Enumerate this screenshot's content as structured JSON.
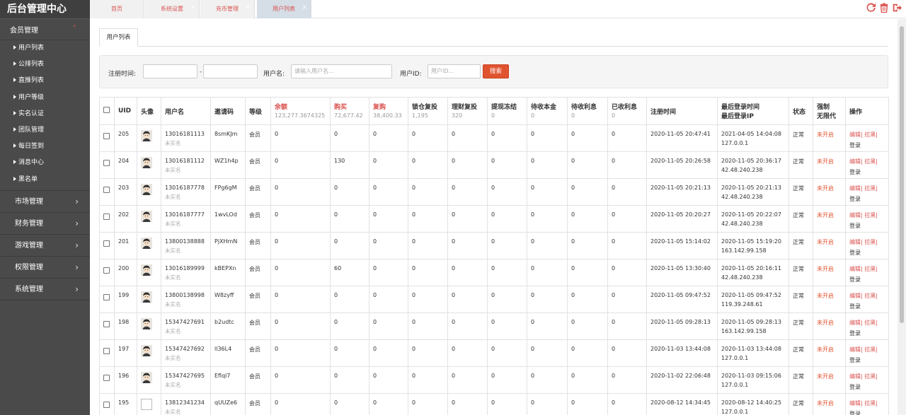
{
  "brand": "后台管理中心",
  "sidebar": {
    "groups": [
      {
        "label": "会员管理",
        "open": true,
        "items": [
          "用户列表",
          "公排列表",
          "直推列表",
          "用户等级",
          "实名认证",
          "团队管理",
          "每日签到",
          "消息中心",
          "黑名单"
        ]
      },
      {
        "label": "市场管理"
      },
      {
        "label": "财务管理"
      },
      {
        "label": "游戏管理"
      },
      {
        "label": "权限管理"
      },
      {
        "label": "系统管理"
      }
    ]
  },
  "top_tabs": [
    {
      "label": "首页",
      "closable": false,
      "active": false
    },
    {
      "label": "系统设置",
      "closable": true,
      "active": false
    },
    {
      "label": "充币管理",
      "closable": true,
      "active": false
    },
    {
      "label": "用户列表",
      "closable": true,
      "active": true
    }
  ],
  "top_icons": [
    "refresh-icon",
    "trash-icon",
    "logout-icon"
  ],
  "page_tab": "用户列表",
  "search": {
    "reg_time_label": "注册时间:",
    "username_label": "用户名:",
    "username_placeholder": "请输入用户名...",
    "userid_label": "用户ID:",
    "userid_placeholder": "用户ID...",
    "button": "搜索"
  },
  "table": {
    "headers": {
      "uid": "UID",
      "avatar": "头像",
      "username": "用户名",
      "invite": "邀请码",
      "level": "等级",
      "balance": {
        "label": "余额",
        "total": "123,277.3674325"
      },
      "buy": {
        "label": "购买",
        "total": "72,677.42"
      },
      "rebuy": {
        "label": "复购",
        "total": "38,400.33"
      },
      "lock": {
        "label": "锁仓复投",
        "total": "1,195"
      },
      "finance": {
        "label": "理财复投",
        "total": "320"
      },
      "freeze": {
        "label": "提现冻结",
        "total": "0"
      },
      "pending_principal": {
        "label": "待收本金",
        "total": "0"
      },
      "pending_interest": {
        "label": "待收利息",
        "total": "0"
      },
      "received_interest": {
        "label": "已收利息",
        "total": "0"
      },
      "reg_time": "注册时间",
      "last_login": "最后登录时间",
      "last_ip": "最后登录IP",
      "status": "状态",
      "force_1": "强制",
      "force_2": "无限代",
      "ops": "操作"
    },
    "rows": [
      {
        "uid": "205",
        "phone": "13016181113",
        "realname": "未实名",
        "code": "8smKJm",
        "level": "会员",
        "balance": "0",
        "buy": "0",
        "rebuy": "0",
        "lock": "0",
        "finance": "0",
        "freeze": "0",
        "pp": "0",
        "pi": "0",
        "ri": "0",
        "reg": "2020-11-05 20:47:41",
        "login": "2021-04-05 14:04:08",
        "ip": "127.0.0.1",
        "status": "正常",
        "force": "未开启",
        "op": "编辑| 拉黑|",
        "op2": "登录",
        "broken": false
      },
      {
        "uid": "204",
        "phone": "13016181112",
        "realname": "未实名",
        "code": "WZ1h4p",
        "level": "会员",
        "balance": "0",
        "buy": "130",
        "rebuy": "0",
        "lock": "0",
        "finance": "0",
        "freeze": "0",
        "pp": "0",
        "pi": "0",
        "ri": "0",
        "reg": "2020-11-05 20:26:58",
        "login": "2020-11-05 20:36:17",
        "ip": "42.48.240.238",
        "status": "正常",
        "force": "未开启",
        "op": "编辑| 拉黑|",
        "op2": "登录",
        "broken": false
      },
      {
        "uid": "203",
        "phone": "13016187778",
        "realname": "未实名",
        "code": "FPg6gM",
        "level": "会员",
        "balance": "0",
        "buy": "0",
        "rebuy": "0",
        "lock": "0",
        "finance": "0",
        "freeze": "0",
        "pp": "0",
        "pi": "0",
        "ri": "0",
        "reg": "2020-11-05 20:21:13",
        "login": "2020-11-05 20:21:13",
        "ip": "42.48.240.238",
        "status": "正常",
        "force": "未开启",
        "op": "编辑| 拉黑|",
        "op2": "登录",
        "broken": false
      },
      {
        "uid": "202",
        "phone": "13016187777",
        "realname": "未实名",
        "code": "1wvLOd",
        "level": "会员",
        "balance": "0",
        "buy": "0",
        "rebuy": "0",
        "lock": "0",
        "finance": "0",
        "freeze": "0",
        "pp": "0",
        "pi": "0",
        "ri": "0",
        "reg": "2020-11-05 20:20:27",
        "login": "2020-11-05 20:22:07",
        "ip": "42.48.240.238",
        "status": "正常",
        "force": "未开启",
        "op": "编辑| 拉黑|",
        "op2": "登录",
        "broken": false
      },
      {
        "uid": "201",
        "phone": "13800138888",
        "realname": "未实名",
        "code": "PjXHmN",
        "level": "会员",
        "balance": "0",
        "buy": "0",
        "rebuy": "0",
        "lock": "0",
        "finance": "0",
        "freeze": "0",
        "pp": "0",
        "pi": "0",
        "ri": "0",
        "reg": "2020-11-05 15:14:02",
        "login": "2020-11-05 15:19:20",
        "ip": "163.142.99.158",
        "status": "正常",
        "force": "未开启",
        "op": "编辑| 拉黑|",
        "op2": "登录",
        "broken": false
      },
      {
        "uid": "200",
        "phone": "13016189999",
        "realname": "未实名",
        "code": "kBEPXn",
        "level": "会员",
        "balance": "0",
        "buy": "60",
        "rebuy": "0",
        "lock": "0",
        "finance": "0",
        "freeze": "0",
        "pp": "0",
        "pi": "0",
        "ri": "0",
        "reg": "2020-11-05 13:30:40",
        "login": "2020-11-05 20:16:11",
        "ip": "42.48.240.238",
        "status": "正常",
        "force": "未开启",
        "op": "编辑| 拉黑|",
        "op2": "登录",
        "broken": false
      },
      {
        "uid": "199",
        "phone": "13800138998",
        "realname": "未实名",
        "code": "W8zyff",
        "level": "会员",
        "balance": "0",
        "buy": "0",
        "rebuy": "0",
        "lock": "0",
        "finance": "0",
        "freeze": "0",
        "pp": "0",
        "pi": "0",
        "ri": "0",
        "reg": "2020-11-05 09:47:52",
        "login": "2020-11-05 09:47:52",
        "ip": "119.39.248.61",
        "status": "正常",
        "force": "未开启",
        "op": "编辑| 拉黑|",
        "op2": "登录",
        "broken": false
      },
      {
        "uid": "198",
        "phone": "15347427691",
        "realname": "未实名",
        "code": "b2udtc",
        "level": "会员",
        "balance": "0",
        "buy": "0",
        "rebuy": "0",
        "lock": "0",
        "finance": "0",
        "freeze": "0",
        "pp": "0",
        "pi": "0",
        "ri": "0",
        "reg": "2020-11-05 09:28:13",
        "login": "2020-11-05 09:28:13",
        "ip": "163.142.99.158",
        "status": "正常",
        "force": "未开启",
        "op": "编辑| 拉黑|",
        "op2": "登录",
        "broken": false
      },
      {
        "uid": "197",
        "phone": "15347427692",
        "realname": "未实名",
        "code": "ll36L4",
        "level": "会员",
        "balance": "0",
        "buy": "0",
        "rebuy": "0",
        "lock": "0",
        "finance": "0",
        "freeze": "0",
        "pp": "0",
        "pi": "0",
        "ri": "0",
        "reg": "2020-11-03 13:44:08",
        "login": "2020-11-03 13:44:08",
        "ip": "127.0.0.1",
        "status": "正常",
        "force": "未开启",
        "op": "编辑| 拉黑|",
        "op2": "登录",
        "broken": false
      },
      {
        "uid": "196",
        "phone": "15347427695",
        "realname": "未实名",
        "code": "Eflql7",
        "level": "会员",
        "balance": "0",
        "buy": "0",
        "rebuy": "0",
        "lock": "0",
        "finance": "0",
        "freeze": "0",
        "pp": "0",
        "pi": "0",
        "ri": "0",
        "reg": "2020-11-02 22:06:48",
        "login": "2020-11-03 09:15:06",
        "ip": "127.0.0.1",
        "status": "正常",
        "force": "未开启",
        "op": "编辑| 拉黑|",
        "op2": "登录",
        "broken": false
      },
      {
        "uid": "195",
        "phone": "13812341234",
        "realname": "未实名",
        "code": "qUUZe6",
        "level": "会员",
        "balance": "0",
        "buy": "0",
        "rebuy": "0",
        "lock": "0",
        "finance": "0",
        "freeze": "0",
        "pp": "0",
        "pi": "0",
        "ri": "0",
        "reg": "2020-08-12 14:34:45",
        "login": "2020-08-12 14:40:25",
        "ip": "127.0.0.1",
        "status": "正常",
        "force": "未开启",
        "op": "编辑| 拉黑|",
        "op2": "登录",
        "broken": true
      }
    ]
  }
}
